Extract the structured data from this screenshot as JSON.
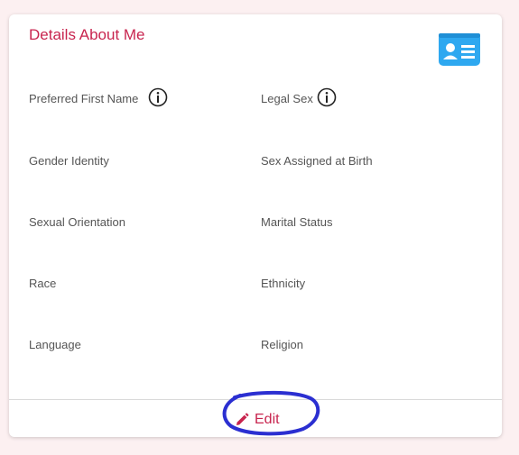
{
  "card": {
    "title": "Details About Me",
    "icon": "id-card-icon",
    "fields": {
      "preferred_first_name": "Preferred First Name",
      "legal_sex": "Legal Sex",
      "gender_identity": "Gender Identity",
      "sex_assigned_at_birth": "Sex Assigned at Birth",
      "sexual_orientation": "Sexual Orientation",
      "marital_status": "Marital Status",
      "race": "Race",
      "ethnicity": "Ethnicity",
      "language": "Language",
      "religion": "Religion"
    },
    "edit_label": "Edit"
  },
  "colors": {
    "accent": "#c8254f",
    "icon_blue": "#2ea8f0",
    "annotation_circle": "#2b2fd1",
    "background": "#fcf0f1"
  }
}
